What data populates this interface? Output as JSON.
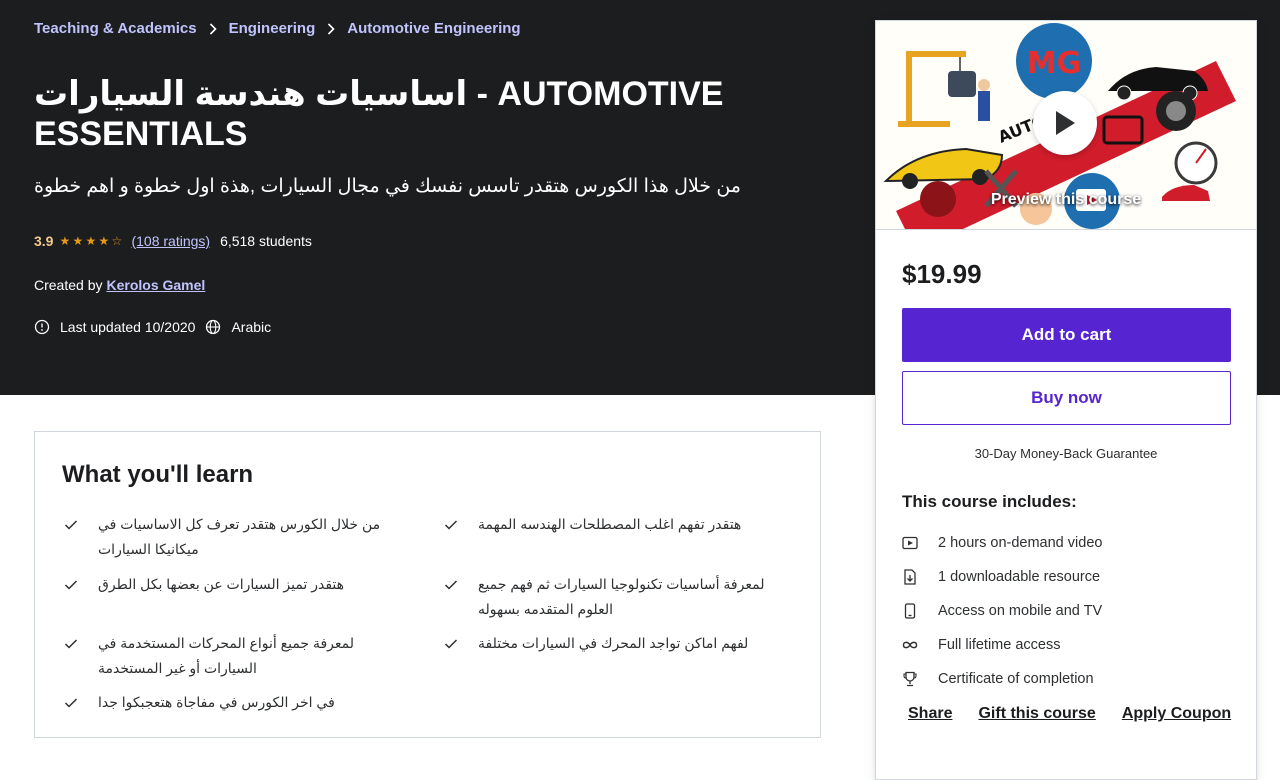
{
  "breadcrumb": [
    "Teaching & Academics",
    "Engineering",
    "Automotive Engineering"
  ],
  "course": {
    "title": "اساسيات هندسة السيارات - AUTOMOTIVE ESSENTIALS",
    "subtitle": "من خلال هذا الكورس هتقدر تاسس نفسك في مجال السيارات ,هذة اول خطوة و اهم خطوة",
    "rating": "3.9",
    "rating_stars": 3.9,
    "ratings_count": "(108 ratings)",
    "students": "6,518 students",
    "created_by_label": "Created by",
    "instructor": "Kerolos Gamel",
    "last_updated": "Last updated 10/2020",
    "language": "Arabic"
  },
  "learn": {
    "title": "What you'll learn",
    "items": [
      "من خلال الكورس هتقدر تعرف كل الاساسيات في ميكانيكا السيارات",
      "هتقدر تفهم اغلب المصطلحات الهندسه المهمة",
      "هتقدر تميز السيارات عن بعضها بكل الطرق",
      "لمعرفة أساسيات تكنولوجيا السيارات ثم فهم جميع العلوم المتقدمه بسهوله",
      "لمعرفة جميع أنواع المحركات المستخدمة في السيارات أو غير المستخدمة",
      "لفهم اماكن تواجد المحرك في السيارات مختلفة",
      "في اخر الكورس في مفاجاة هتعجبكوا جدا"
    ]
  },
  "sidebar": {
    "preview_label": "Preview this course",
    "price": "$19.99",
    "add_to_cart": "Add to cart",
    "buy_now": "Buy now",
    "guarantee": "30-Day Money-Back Guarantee",
    "includes_title": "This course includes:",
    "includes": [
      {
        "icon": "video-icon",
        "label": "2 hours on-demand video"
      },
      {
        "icon": "file-download-icon",
        "label": "1 downloadable resource"
      },
      {
        "icon": "mobile-icon",
        "label": "Access on mobile and TV"
      },
      {
        "icon": "infinity-icon",
        "label": "Full lifetime access"
      },
      {
        "icon": "trophy-icon",
        "label": "Certificate of completion"
      }
    ],
    "share": "Share",
    "gift": "Gift this course",
    "coupon": "Apply Coupon"
  },
  "colors": {
    "hero_bg": "#1c1d1f",
    "link": "#c0c4fc",
    "star": "#e59819",
    "rating": "#f3ca8c",
    "primary": "#5624d0"
  }
}
